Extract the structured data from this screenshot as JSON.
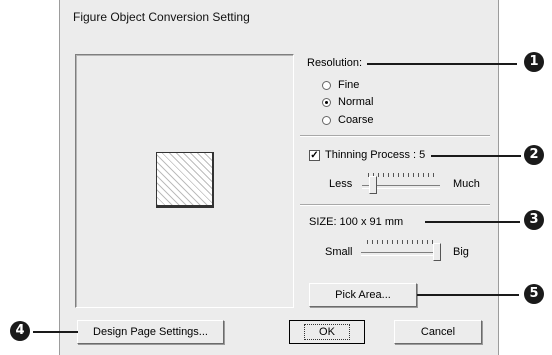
{
  "dialog": {
    "title": "Figure Object Conversion Setting"
  },
  "resolution": {
    "label": "Resolution:",
    "options": [
      "Fine",
      "Normal",
      "Coarse"
    ],
    "selected": "Normal"
  },
  "thinning": {
    "label": "Thinning Process : 5",
    "checked": true,
    "slider": {
      "min_label": "Less",
      "max_label": "Much",
      "level": 0.1
    }
  },
  "size": {
    "label": "SIZE:  100 x 91 mm",
    "slider": {
      "min_label": "Small",
      "max_label": "Big",
      "level": 1.0
    }
  },
  "buttons": {
    "pick_area": "Pick Area...",
    "design_page_settings": "Design Page Settings...",
    "ok": "OK",
    "cancel": "Cancel"
  },
  "callouts": [
    "1",
    "2",
    "3",
    "4",
    "5"
  ],
  "colors": {
    "marker": "#1a1a1a",
    "dialog_bg": "#ececec"
  }
}
